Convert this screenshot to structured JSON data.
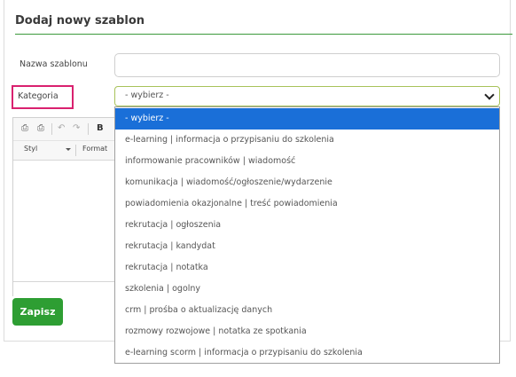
{
  "form": {
    "title": "Dodaj nowy szablon",
    "name_label": "Nazwa szablonu",
    "name_value": "",
    "category_label": "Kategoria",
    "category_value": "- wybierz -",
    "save_label": "Zapisz"
  },
  "editor": {
    "toolbar": {
      "style_combo": "Styl",
      "format_combo": "Format",
      "bold_label": "B"
    }
  },
  "dropdown": {
    "options": [
      "- wybierz -",
      "e-learning | informacja o przypisaniu do szkolenia",
      "informowanie pracowników | wiadomość",
      "komunikacja | wiadomość/ogłoszenie/wydarzenie",
      "powiadomienia okazjonalne | treść powiadomienia",
      "rekrutacja | ogłoszenia",
      "rekrutacja | kandydat",
      "rekrutacja | notatka",
      "szkolenia | ogolny",
      "crm | prośba o aktualizację danych",
      "rozmowy rozwojowe | notatka ze spotkania",
      "e-learning scorm | informacja o przypisaniu do szkolenia"
    ],
    "selected_index": 0
  },
  "colors": {
    "accent_green": "#2e9e33",
    "highlight_pink": "#d9216f",
    "selected_blue": "#1a6fd8"
  }
}
